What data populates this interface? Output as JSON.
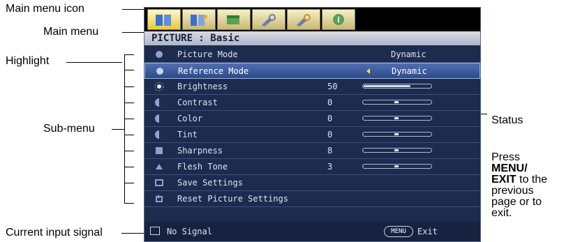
{
  "callouts": {
    "main_menu_icon": "Main menu icon",
    "main_menu": "Main menu",
    "highlight": "Highlight",
    "sub_menu": "Sub-menu",
    "status": "Status",
    "press_menu_prefix": "Press",
    "press_menu_bold1": "MENU/",
    "press_menu_bold2": "EXIT",
    "press_menu_rest1": " to the",
    "press_menu_rest2": "previous",
    "press_menu_rest3": "page or to",
    "press_menu_rest4": "exit.",
    "current_input_signal": "Current input signal"
  },
  "osd": {
    "tabs": [
      {
        "icon": "picture-tab-icon",
        "active": true
      },
      {
        "icon": "advanced-picture-tab-icon",
        "active": false
      },
      {
        "icon": "display-tab-icon",
        "active": false
      },
      {
        "icon": "setup-basic-tab-icon",
        "active": false
      },
      {
        "icon": "setup-advanced-tab-icon",
        "active": false
      },
      {
        "icon": "information-tab-icon",
        "active": false
      }
    ],
    "menu_title": "PICTURE : Basic",
    "rows": [
      {
        "label": "Picture Mode",
        "value": "Dynamic",
        "status": "Dynamic"
      },
      {
        "label": "Reference Mode",
        "value": "Dynamic",
        "status": "Dynamic"
      },
      {
        "label": "Brightness",
        "value": "50",
        "slider": 0.7
      },
      {
        "label": "Contrast",
        "value": "0",
        "slider": 0.5
      },
      {
        "label": "Color",
        "value": "0",
        "slider": 0.5
      },
      {
        "label": "Tint",
        "value": "0",
        "slider": 0.5
      },
      {
        "label": "Sharpness",
        "value": "8",
        "slider": 0.5
      },
      {
        "label": "Flesh Tone",
        "value": "3",
        "slider": 0.5
      },
      {
        "label": "Save Settings"
      },
      {
        "label": "Reset Picture Settings"
      }
    ],
    "status_bar": {
      "input_signal": "No Signal",
      "menu_button": "MENU",
      "exit_label": "Exit"
    }
  }
}
